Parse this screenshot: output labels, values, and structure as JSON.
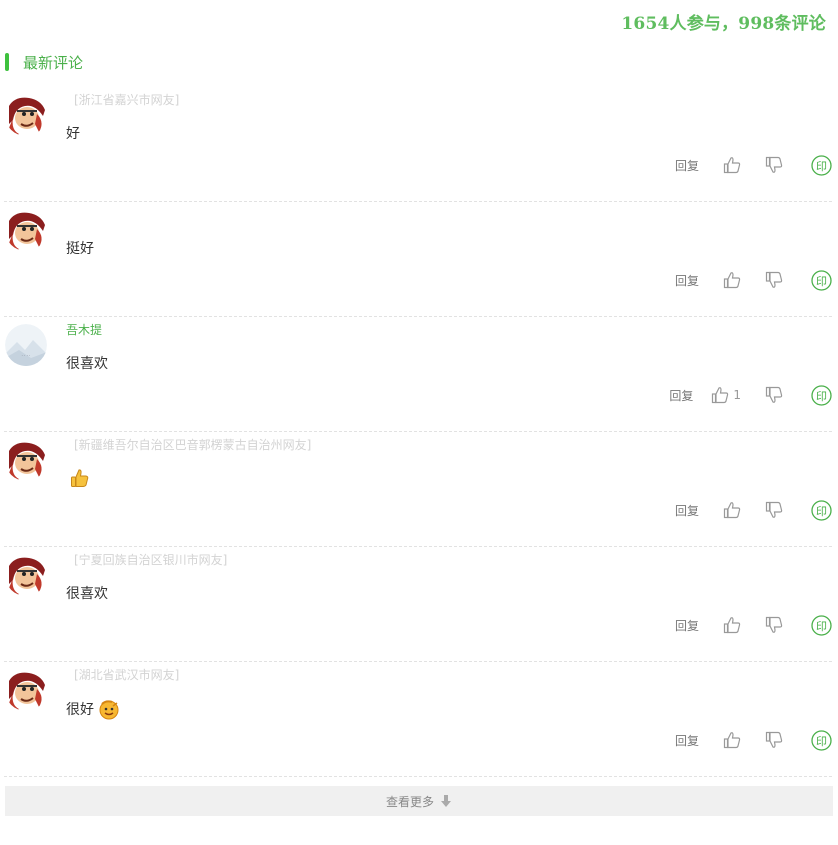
{
  "header": {
    "stats": "1654人参与，998条评论"
  },
  "section": {
    "title": "最新评论"
  },
  "labels": {
    "reply": "回复"
  },
  "comments": [
    {
      "user": "[浙江省嘉兴市网友]",
      "named": false,
      "text": "好",
      "emoji": "",
      "likes": "",
      "avatar": "cartoon"
    },
    {
      "user": "",
      "named": false,
      "text": "挺好",
      "emoji": "",
      "likes": "",
      "avatar": "cartoon"
    },
    {
      "user": "吾木提",
      "named": true,
      "text": "很喜欢",
      "emoji": "",
      "likes": "1",
      "avatar": "landscape"
    },
    {
      "user": "[新疆维吾尔自治区巴音郭楞蒙古自治州网友]",
      "named": false,
      "text": "",
      "emoji": "thumbs-up",
      "likes": "",
      "avatar": "cartoon"
    },
    {
      "user": "[宁夏回族自治区银川市网友]",
      "named": false,
      "text": "很喜欢",
      "emoji": "",
      "likes": "",
      "avatar": "cartoon"
    },
    {
      "user": "[湖北省武汉市网友]",
      "named": false,
      "text": "很好",
      "emoji": "face",
      "likes": "",
      "avatar": "cartoon"
    }
  ],
  "footer": {
    "more_label": "查看更多"
  },
  "colors": {
    "accent": "#4ab04a",
    "stats": "#5fbd5f",
    "muted": "#d3d3d3"
  }
}
